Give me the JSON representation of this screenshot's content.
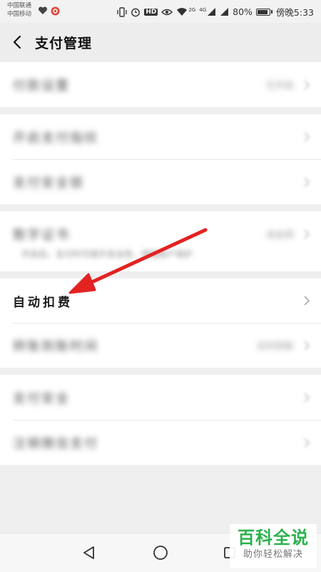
{
  "status_bar": {
    "carrier_1": "中国联通",
    "carrier_2": "中国移动",
    "network_label": "HD",
    "signal_tag": "4G",
    "wifi_tag": "2G",
    "battery_percent": "80%",
    "time": "傍晚5:33"
  },
  "header": {
    "title": "支付管理"
  },
  "rows": {
    "r1": {
      "label": "付款设置",
      "value": "已开启"
    },
    "r2": {
      "label": "开启支付指纹"
    },
    "r3": {
      "label": "支付安全锁"
    },
    "r4": {
      "label": "数字证书",
      "value": "未启用",
      "sub": "开启后，支付时可提升安全性，增强账户保护"
    },
    "r5": {
      "label": "自动扣费"
    },
    "r6": {
      "label": "转账到账时间",
      "value": "实时到账"
    },
    "r7": {
      "label": "支付安全"
    },
    "r8": {
      "label": "注销微信支付"
    }
  },
  "watermark": {
    "title": "百科全说",
    "subtitle": "助你轻松解决"
  },
  "annotation": {
    "arrow_color": "#e32222"
  }
}
